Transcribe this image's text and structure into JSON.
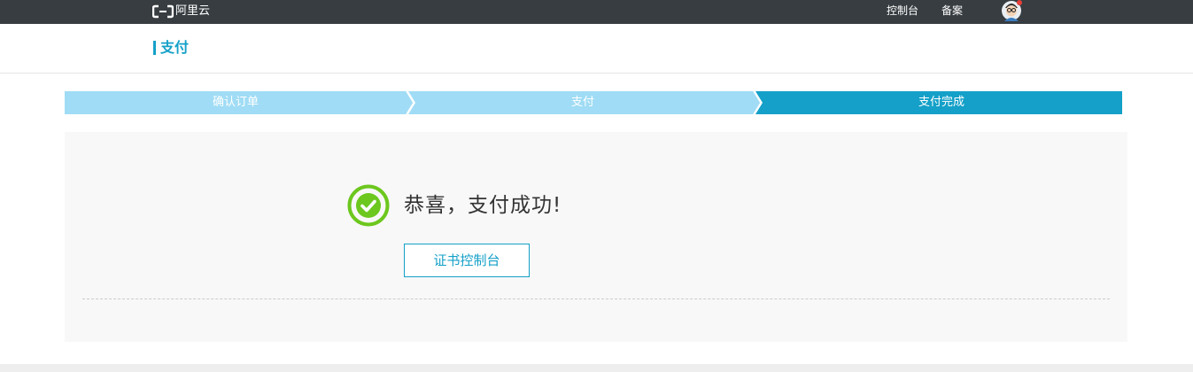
{
  "topbar": {
    "logo_text": "阿里云",
    "nav": [
      {
        "label": "控制台"
      },
      {
        "label": "备案"
      }
    ]
  },
  "header": {
    "title": "支付"
  },
  "steps": [
    {
      "label": "确认订单",
      "state": "done"
    },
    {
      "label": "支付",
      "state": "done"
    },
    {
      "label": "支付完成",
      "state": "active"
    }
  ],
  "result": {
    "message": "恭喜，支付成功!",
    "button_label": "证书控制台"
  },
  "colors": {
    "topbar_bg": "#373d41",
    "accent": "#14a0c8",
    "step_inactive": "#a0dcf5",
    "step_active": "#14a0c8",
    "success": "#6cc71e",
    "panel_bg": "#f8f8f8"
  },
  "icons": {
    "logo": "aliyun-logo-icon",
    "avatar": "avatar-icon",
    "success": "check-circle-icon"
  }
}
